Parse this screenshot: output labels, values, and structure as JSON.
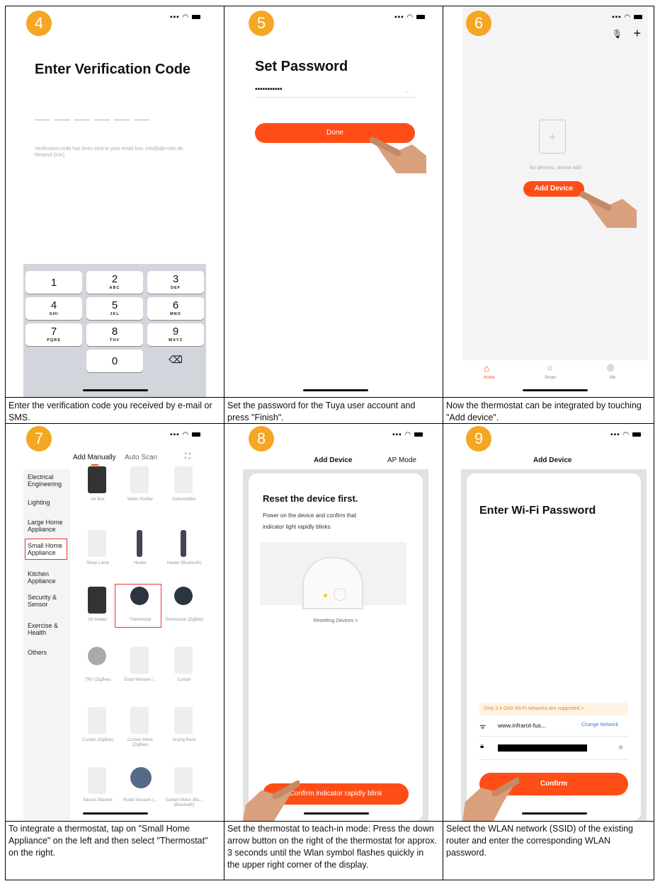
{
  "steps": [
    {
      "num": "4",
      "title": "Enter Verification Code",
      "verification_text": "Verification code has been sent to your email box: info@djb-side.de, Resend (53s)",
      "keypad": [
        {
          "d": "1",
          "l": ""
        },
        {
          "d": "2",
          "l": "ABC"
        },
        {
          "d": "3",
          "l": "DEF"
        },
        {
          "d": "4",
          "l": "GHI"
        },
        {
          "d": "5",
          "l": "JKL"
        },
        {
          "d": "6",
          "l": "MNO"
        },
        {
          "d": "7",
          "l": "PQRS"
        },
        {
          "d": "8",
          "l": "TUV"
        },
        {
          "d": "9",
          "l": "WXYZ"
        },
        {
          "d": "0",
          "l": ""
        }
      ],
      "delete_glyph": "⌫",
      "caption": "Enter the verification code you received by e-mail or SMS."
    },
    {
      "num": "5",
      "title": "Set Password",
      "password_mask": "•••••••••••",
      "button": "Done",
      "caption": "Set the password for the Tuya user account and press \"Finish\"."
    },
    {
      "num": "6",
      "empty_text": "No devices, please add",
      "button": "Add Device",
      "tabs": [
        {
          "label": "Home"
        },
        {
          "label": "Smart"
        },
        {
          "label": "Me"
        }
      ],
      "caption": "Now the thermostat can be integrated by touching \"Add device\"."
    },
    {
      "num": "7",
      "tabs": [
        "Add Manually",
        "Auto Scan"
      ],
      "categories": [
        "Electrical Engineering",
        "Lighting",
        "Large Home Appliance",
        "Small Home Appliance",
        "Kitchen Appliance",
        "Security & Sensor",
        "Exercise & Health",
        "Others"
      ],
      "devices": [
        "Air Box",
        "Water Purifier",
        "Dehumidifier",
        "Sleep Lamp",
        "Heater",
        "Heater (Bluetooth)",
        "Oil Heater",
        "Thermostat",
        "Thermostat (ZigBee)",
        "TRV (ZigBee)",
        "Dood Window (...",
        "Curtain",
        "Curtain (ZigBee)",
        "Curtain Motor (ZigBee)",
        "Drying Rack",
        "Electric Blanket",
        "Robot Vacuum (...",
        "Curtain Motor (Ba... (Bluetooth)"
      ],
      "caption": "To integrate a thermostat, tap on \"Small Home Appliance\" on the left and then select \"Thermostat\" on the right."
    },
    {
      "num": "8",
      "header": "Add Device",
      "mode": "AP Mode",
      "title": "Reset the device first.",
      "body": "Power on the device and confirm that indicator light rapidly blinks",
      "link": "Resetting Devices >",
      "button": "Confirm indicator rapidly blink",
      "caption": "Set the thermostat to teach-in mode: Press the down arrow button on the right of the thermostat for approx. 3 seconds until the Wlan symbol flashes quickly in the upper right corner of the display."
    },
    {
      "num": "9",
      "header": "Add Device",
      "title": "Enter Wi-Fi Password",
      "notice": "Only 2.4 GHz Wi-Fi networks are supported >",
      "ssid": "www.infrarot-fus...",
      "change": "Change Network",
      "button": "Confirm",
      "caption": "Select the WLAN network (SSID) of the existing router and enter the corresponding WLAN password."
    }
  ],
  "colors": {
    "accent": "#ff4d17",
    "badge": "#f5a623",
    "highlight": "#e5343a"
  }
}
